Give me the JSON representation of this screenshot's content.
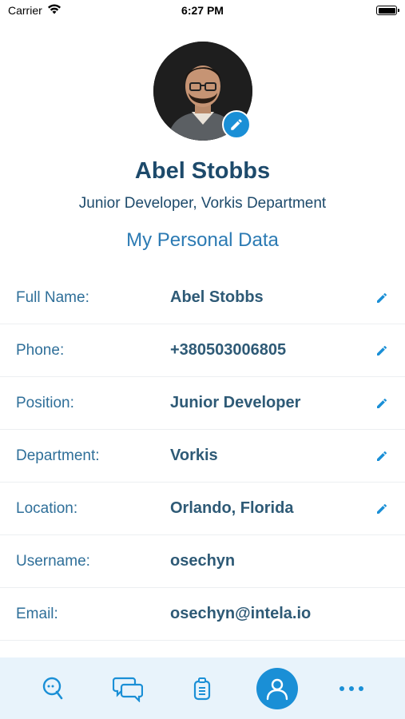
{
  "status_bar": {
    "carrier": "Carrier",
    "time": "6:27 PM"
  },
  "profile": {
    "name": "Abel Stobbs",
    "subtitle": "Junior Developer, Vorkis Department",
    "section_title": "My Personal Data"
  },
  "fields": [
    {
      "label": "Full Name:",
      "value": "Abel Stobbs",
      "editable": true
    },
    {
      "label": "Phone:",
      "value": "+380503006805",
      "editable": true
    },
    {
      "label": "Position:",
      "value": "Junior Developer",
      "editable": true
    },
    {
      "label": "Department:",
      "value": "Vorkis",
      "editable": true
    },
    {
      "label": "Location:",
      "value": "Orlando, Florida",
      "editable": true
    },
    {
      "label": "Username:",
      "value": "osechyn",
      "editable": false
    },
    {
      "label": "Email:",
      "value": "osechyn@intela.io",
      "editable": false
    }
  ],
  "tab_bar": {
    "tabs": [
      "search-chat-icon",
      "conversations-icon",
      "clipboard-icon",
      "profile-icon",
      "more-icon"
    ],
    "active": "profile-icon"
  },
  "colors": {
    "accent": "#1a8fd6",
    "heading": "#1d4a6b",
    "tab_bar_bg": "#e8f3fb"
  }
}
